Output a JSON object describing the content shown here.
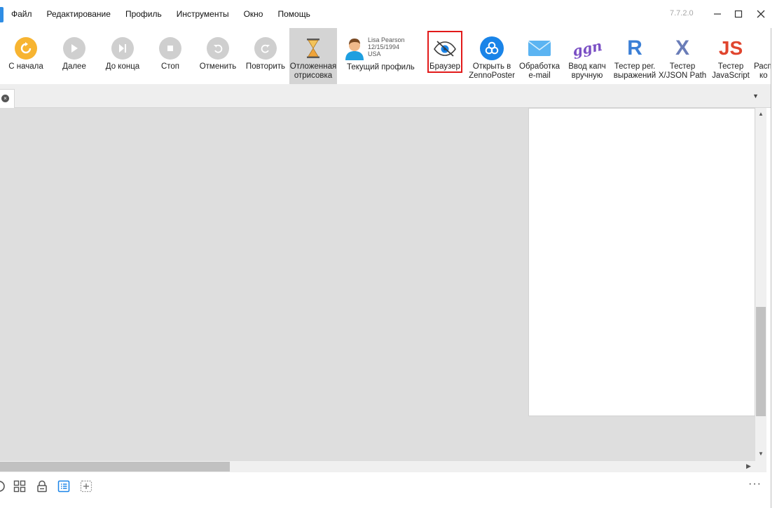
{
  "menu": {
    "items": [
      "Файл",
      "Редактирование",
      "Профиль",
      "Инструменты",
      "Окно",
      "Помощь"
    ],
    "version": "7.7.2.0"
  },
  "window": {
    "minimize": "—",
    "maximize": "☐",
    "close": "✕"
  },
  "toolbar": {
    "restart_label": "С начала",
    "next_label": "Далее",
    "to_end_label": "До конца",
    "stop_label": "Стоп",
    "undo_label": "Отменить",
    "redo_label": "Повторить",
    "deferred_line1": "Отложенная",
    "deferred_line2": "отрисовка",
    "profile": {
      "name": "Lisa Pearson",
      "dob": "12/15/1994",
      "country": "USA",
      "label": "Текущий профиль"
    },
    "browser_label": "Браузер",
    "open_zp_line1": "Открыть в",
    "open_zp_line2": "ZennoPoster",
    "email_line1": "Обработка",
    "email_line2": "e-mail",
    "captcha_line1": "Ввод капч",
    "captcha_line2": "вручную",
    "captcha_glyph": "ggn",
    "regex_line1": "Тестер рег.",
    "regex_line2": "выражений",
    "regex_glyph": "R",
    "xpath_line1": "Тестер",
    "xpath_line2": "X/JSON Path",
    "xpath_glyph": "X",
    "js_line1": "Тестер",
    "js_line2": "JavaScript",
    "js_glyph": "JS",
    "more_line1": "Распо",
    "more_line2": "ко"
  },
  "tabs": {
    "close_glyph": "×",
    "dropdown_glyph": "▼"
  },
  "scroll": {
    "up": "▲",
    "down": "▼",
    "right": "▶"
  },
  "bottombar": {
    "more": "···"
  },
  "colors": {
    "accent": "#1a84e8",
    "restart": "#f7b431",
    "highlight_border": "#e21a1a",
    "regex": "#3b7fd6",
    "xpath": "#6a7db8",
    "js": "#e0452e",
    "captcha": "#7a4fc4"
  }
}
